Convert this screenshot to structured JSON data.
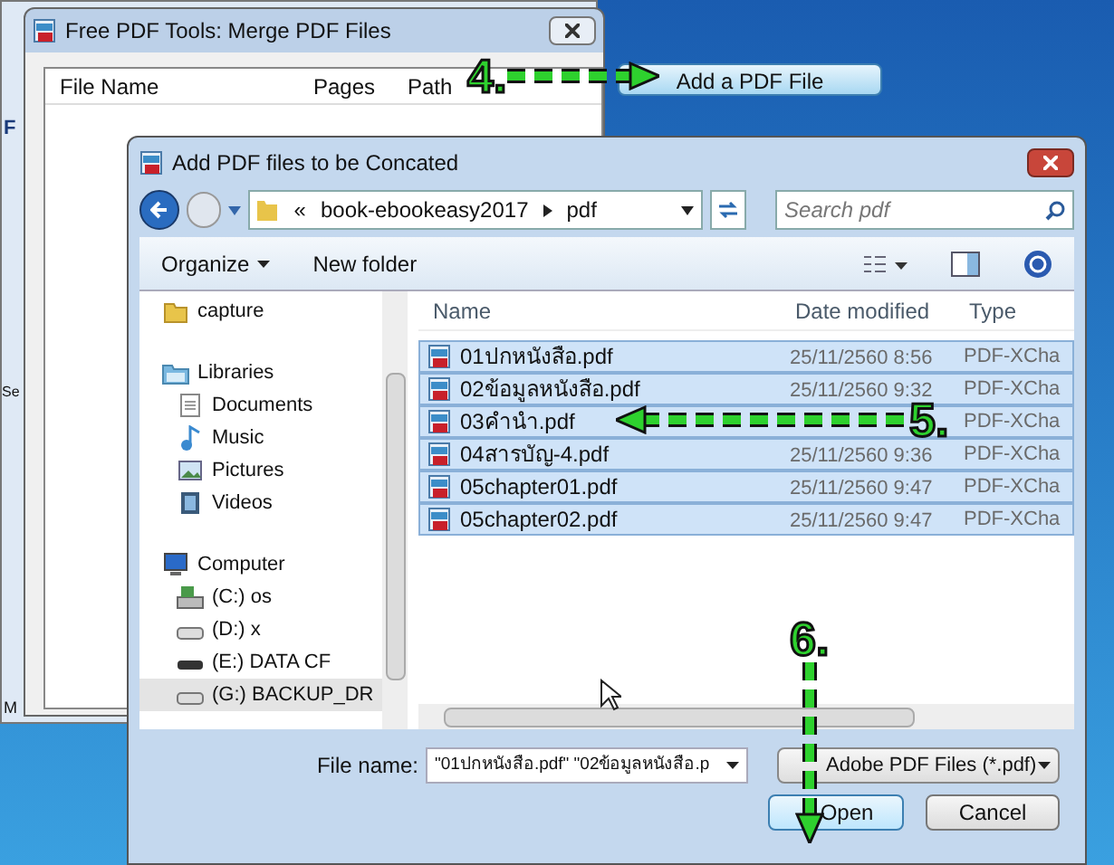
{
  "background_window": {
    "fragments": [
      "F",
      "Se",
      "M"
    ]
  },
  "merge_window": {
    "title": "Free PDF Tools: Merge PDF Files",
    "columns": [
      "File Name",
      "Pages",
      "Path"
    ],
    "add_button": "Add a PDF File"
  },
  "dialog": {
    "title": "Add PDF files to be Concated",
    "breadcrumb": {
      "overflow": "«",
      "path": [
        "book-ebookeasy2017",
        "pdf"
      ]
    },
    "search": {
      "placeholder": "Search pdf"
    },
    "toolbar": [
      "Organize",
      "New folder"
    ],
    "nav": [
      {
        "label": "capture",
        "kind": "folder",
        "selected": false
      },
      {
        "label": "Libraries",
        "kind": "library",
        "selected": false,
        "children": [
          {
            "label": "Documents",
            "kind": "document",
            "selected": false
          },
          {
            "label": "Music",
            "kind": "music",
            "selected": false
          },
          {
            "label": "Pictures",
            "kind": "pictures",
            "selected": false
          },
          {
            "label": "Videos",
            "kind": "videos",
            "selected": false
          }
        ]
      },
      {
        "label": "Computer",
        "kind": "computer",
        "selected": false,
        "children": [
          {
            "label": "(C:) os",
            "kind": "system-drive",
            "selected": false
          },
          {
            "label": "(D:) x",
            "kind": "drive",
            "selected": false
          },
          {
            "label": "(E:) DATA CF",
            "kind": "card",
            "selected": false
          },
          {
            "label": "(G:) BACKUP_DR",
            "kind": "drive",
            "selected": true
          }
        ]
      }
    ],
    "columns": [
      "Name",
      "Date modified",
      "Type"
    ],
    "files": [
      {
        "name": "01ปกหนังสือ.pdf",
        "date": "25/11/2560 8:56",
        "type": "PDF-XCha",
        "selected": true
      },
      {
        "name": "02ข้อมูลหนังสือ.pdf",
        "date": "25/11/2560 9:32",
        "type": "PDF-XCha",
        "selected": true
      },
      {
        "name": "03คำนำ.pdf",
        "type": "PDF-XCha",
        "selected": true
      },
      {
        "name": "04สารบัญ-4.pdf",
        "date": "25/11/2560 9:36",
        "type": "PDF-XCha",
        "selected": true
      },
      {
        "name": "05chapter01.pdf",
        "date": "25/11/2560 9:47",
        "type": "PDF-XCha",
        "selected": true
      },
      {
        "name": "05chapter02.pdf",
        "date": "25/11/2560 9:47",
        "type": "PDF-XCha",
        "selected": true
      }
    ],
    "file_name_label": "File name:",
    "file_name_value": "\"01ปกหนังสือ.pdf\" \"02ข้อมูลหนังสือ.p",
    "filter": "Adobe PDF Files (*.pdf)",
    "buttons": [
      "Open",
      "Cancel"
    ]
  },
  "annotations": [
    "4.",
    "5.",
    "6."
  ]
}
